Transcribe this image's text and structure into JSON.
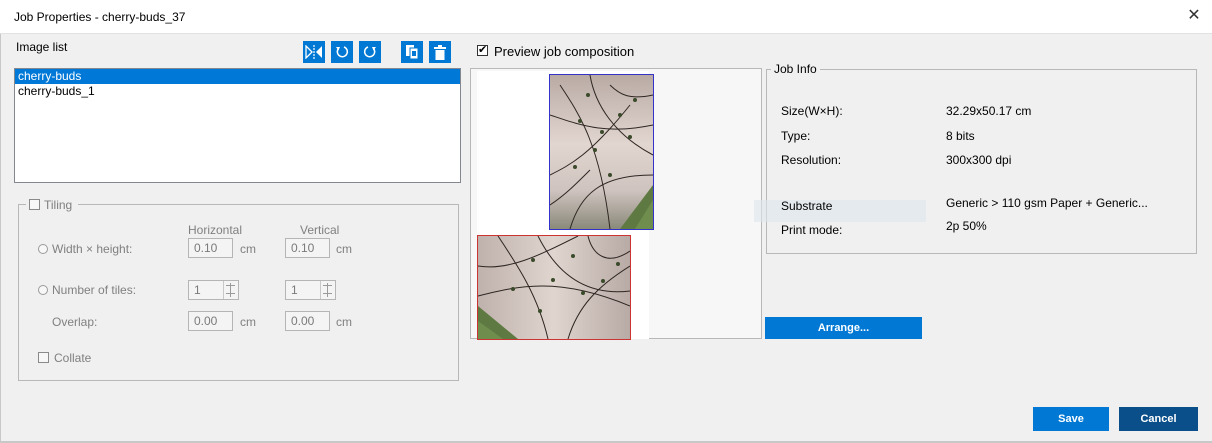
{
  "window": {
    "title": "Job Properties - cherry-buds_37",
    "close_glyph": "✕"
  },
  "image_list": {
    "label": "Image list",
    "items": [
      "cherry-buds",
      "cherry-buds_1"
    ],
    "selected_index": 0
  },
  "toolbar": {
    "icons": [
      "flip-horizontal-icon",
      "rotate-left-icon",
      "rotate-right-icon",
      "copy-image-icon",
      "delete-icon"
    ]
  },
  "tiling": {
    "legend": "Tiling",
    "checked": false,
    "col_horizontal": "Horizontal",
    "col_vertical": "Vertical",
    "width_height_label": "Width × height:",
    "width_value": "0.10",
    "height_value": "0.10",
    "unit": "cm",
    "tiles_label": "Number of tiles:",
    "tiles_h": "1",
    "tiles_v": "1",
    "overlap_label": "Overlap:",
    "overlap_h": "0.00",
    "overlap_v": "0.00",
    "collate_label": "Collate"
  },
  "preview": {
    "label": "Preview job composition",
    "checked": true
  },
  "job_info": {
    "legend": "Job Info",
    "size_label": "Size(W×H):",
    "size_value": "32.29x50.17 cm",
    "type_label": "Type:",
    "type_value": "8 bits",
    "resolution_label": "Resolution:",
    "resolution_value": "300x300 dpi",
    "substrate_label": "Substrate",
    "substrate_value": "Generic > 110 gsm Paper + Generic...",
    "print_mode_label": "Print mode:",
    "print_mode_value": "2p 50%"
  },
  "buttons": {
    "arrange": "Arrange...",
    "save": "Save",
    "cancel": "Cancel"
  },
  "colors": {
    "accent": "#0078d4",
    "cancel": "#0b4f8a",
    "selection": "#0078d7"
  }
}
